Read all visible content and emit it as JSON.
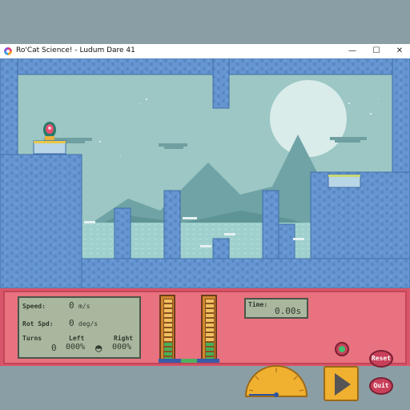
{
  "window": {
    "title": "Ro'Cat Science! - Ludum Dare 41",
    "min_glyph": "—",
    "max_glyph": "☐",
    "close_glyph": "✕"
  },
  "panel": {
    "speed": {
      "label": "Speed:",
      "value": "0",
      "unit": "m/s"
    },
    "rot_spd": {
      "label": "Rot Spd:",
      "value": "0",
      "unit": "deg/s"
    },
    "turns": {
      "label": "Turns",
      "value": "0"
    },
    "left": {
      "label": "Left",
      "value": "000%"
    },
    "right": {
      "label": "Right",
      "value": "000%"
    },
    "time": {
      "label": "Time:",
      "value": "0.00s"
    },
    "reset_label": "Reset",
    "quit_label": "Quit",
    "meter_left_level": 0.33,
    "meter_right_level": 0.33
  },
  "colors": {
    "sky": "#9cc7c4",
    "ice": "#5f8fcf",
    "panel": "#e8727f",
    "lcd": "#a9b79f"
  }
}
